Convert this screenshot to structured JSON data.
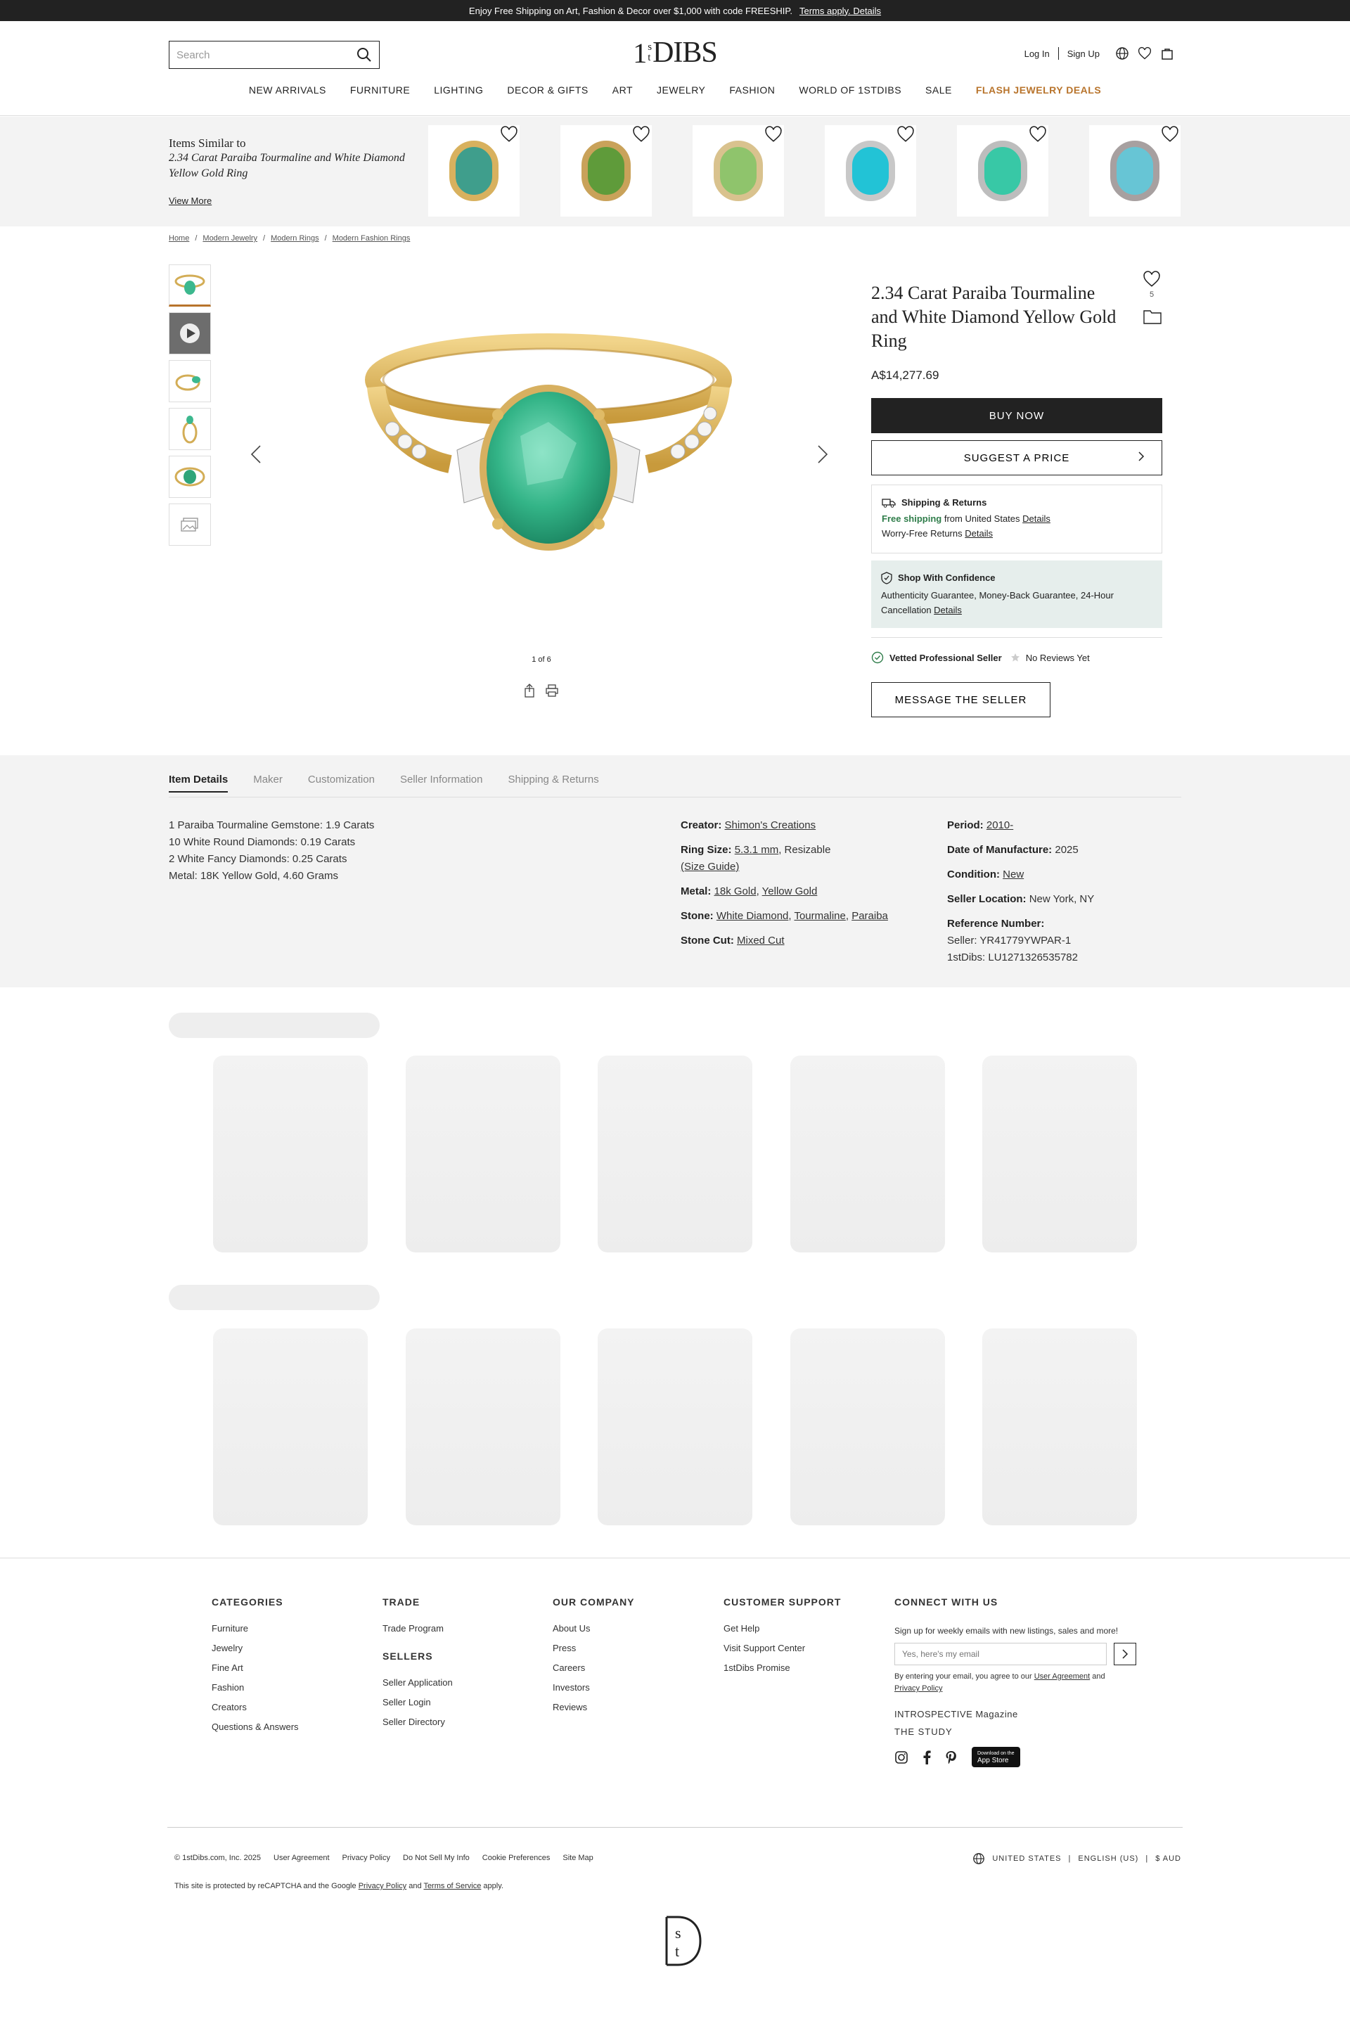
{
  "banner": {
    "text": "Enjoy Free Shipping on Art, Fashion & Decor over $1,000 with code FREESHIP.",
    "link": "Terms apply. Details"
  },
  "header": {
    "search_placeholder": "Search",
    "logo": {
      "one": "1",
      "s": "s",
      "t": "t",
      "dibs": "DIBS"
    },
    "login": "Log In",
    "signup": "Sign Up"
  },
  "nav": [
    "NEW ARRIVALS",
    "FURNITURE",
    "LIGHTING",
    "DECOR & GIFTS",
    "ART",
    "JEWELRY",
    "FASHION",
    "WORLD OF 1STDIBS",
    "SALE",
    "FLASH JEWELRY DEALS"
  ],
  "similar": {
    "title": "Items Similar to",
    "name": "2.34 Carat Paraiba Tourmaline and White Diamond Yellow Gold Ring",
    "view_more": "View More",
    "items": [
      {
        "gem": "#3f9e8c",
        "band": "#d8b15e"
      },
      {
        "gem": "#5f9b3a",
        "band": "#c9a25a"
      },
      {
        "gem": "#8fc46c",
        "band": "#d9c28e"
      },
      {
        "gem": "#22c3d6",
        "band": "#c8c8c8"
      },
      {
        "gem": "#38c8a6",
        "band": "#bdbdbd"
      },
      {
        "gem": "#67c5d5",
        "band": "#a7a0a0"
      }
    ]
  },
  "breadcrumb": [
    "Home",
    "Modern Jewelry",
    "Modern Rings",
    "Modern Fashion Rings"
  ],
  "gallery": {
    "counter": "1 of 6"
  },
  "product": {
    "title": "2.34 Carat Paraiba Tourmaline and White Diamond Yellow Gold Ring",
    "favorites": "5",
    "price": "A$14,277.69",
    "buy": "BUY NOW",
    "suggest": "SUGGEST A PRICE",
    "shipping": {
      "heading": "Shipping & Returns",
      "free": "Free shipping",
      "from": "from United States",
      "details": "Details",
      "returns": "Worry-Free Returns",
      "returns_details": "Details"
    },
    "confidence": {
      "heading": "Shop With Confidence",
      "text": "Authenticity Guarantee, Money-Back Guarantee, 24-Hour Cancellation",
      "details": "Details"
    },
    "vetted": "Vetted Professional Seller",
    "reviews": "No Reviews Yet",
    "message": "MESSAGE THE SELLER"
  },
  "details": {
    "tabs": [
      "Item Details",
      "Maker",
      "Customization",
      "Seller Information",
      "Shipping & Returns"
    ],
    "description": [
      "1 Paraiba Tourmaline Gemstone: 1.9 Carats",
      "10 White Round Diamonds: 0.19 Carats",
      "2 White Fancy Diamonds: 0.25 Carats",
      "Metal: 18K Yellow Gold, 4.60 Grams"
    ],
    "creator_label": "Creator:",
    "creator": "Shimon's Creations",
    "ring_size_label": "Ring Size:",
    "ring_size": "5.3.1 mm",
    "ring_size_rest": ", Resizable",
    "size_guide": "(Size Guide)",
    "metal_label": "Metal:",
    "metal1": "18k Gold",
    "metal2": "Yellow Gold",
    "stone_label": "Stone:",
    "stone1": "White Diamond",
    "stone2": "Tourmaline",
    "stone3": "Paraiba",
    "cut_label": "Stone Cut:",
    "cut": "Mixed Cut",
    "period_label": "Period:",
    "period": "2010-",
    "date_label": "Date of Manufacture:",
    "date": "2025",
    "condition_label": "Condition:",
    "condition": "New",
    "location_label": "Seller Location:",
    "location": "New York, NY",
    "ref_label": "Reference Number:",
    "ref_seller": "Seller: YR41779YWPAR-1",
    "ref_1stdibs": "1stDibs: LU1271326535782"
  },
  "footer": {
    "categories": {
      "title": "CATEGORIES",
      "items": [
        "Furniture",
        "Jewelry",
        "Fine Art",
        "Fashion",
        "Creators",
        "Questions & Answers"
      ]
    },
    "trade": {
      "title": "TRADE",
      "items": [
        "Trade Program"
      ]
    },
    "sellers": {
      "title": "SELLERS",
      "items": [
        "Seller Application",
        "Seller Login",
        "Seller Directory"
      ]
    },
    "company": {
      "title": "OUR COMPANY",
      "items": [
        "About Us",
        "Press",
        "Careers",
        "Investors",
        "Reviews"
      ]
    },
    "support": {
      "title": "CUSTOMER SUPPORT",
      "items": [
        "Get Help",
        "Visit Support Center",
        "1stDibs Promise"
      ]
    },
    "connect": {
      "title": "CONNECT WITH US",
      "signup": "Sign up for weekly emails with new listings, sales and more!",
      "email_placeholder": "Yes, here's my email",
      "agree_pre": "By entering your email, you agree to our",
      "user_agreement": "User Agreement",
      "and": "and",
      "privacy": "Privacy Policy",
      "magazine": "INTROSPECTIVE Magazine",
      "study": "THE STUDY",
      "appstore": "App Store",
      "appstore_top": "Download on the"
    },
    "legal": [
      "© 1stDibs.com, Inc. 2025",
      "User Agreement",
      "Privacy Policy",
      "Do Not Sell My Info",
      "Cookie Preferences",
      "Site Map"
    ],
    "recaptcha": {
      "pre": "This site is protected by reCAPTCHA and the Google",
      "privacy": "Privacy Policy",
      "and": "and",
      "terms": "Terms of Service",
      "post": "apply."
    },
    "locale": {
      "country": "UNITED STATES",
      "language": "ENGLISH (US)",
      "currency": "$ AUD"
    }
  }
}
